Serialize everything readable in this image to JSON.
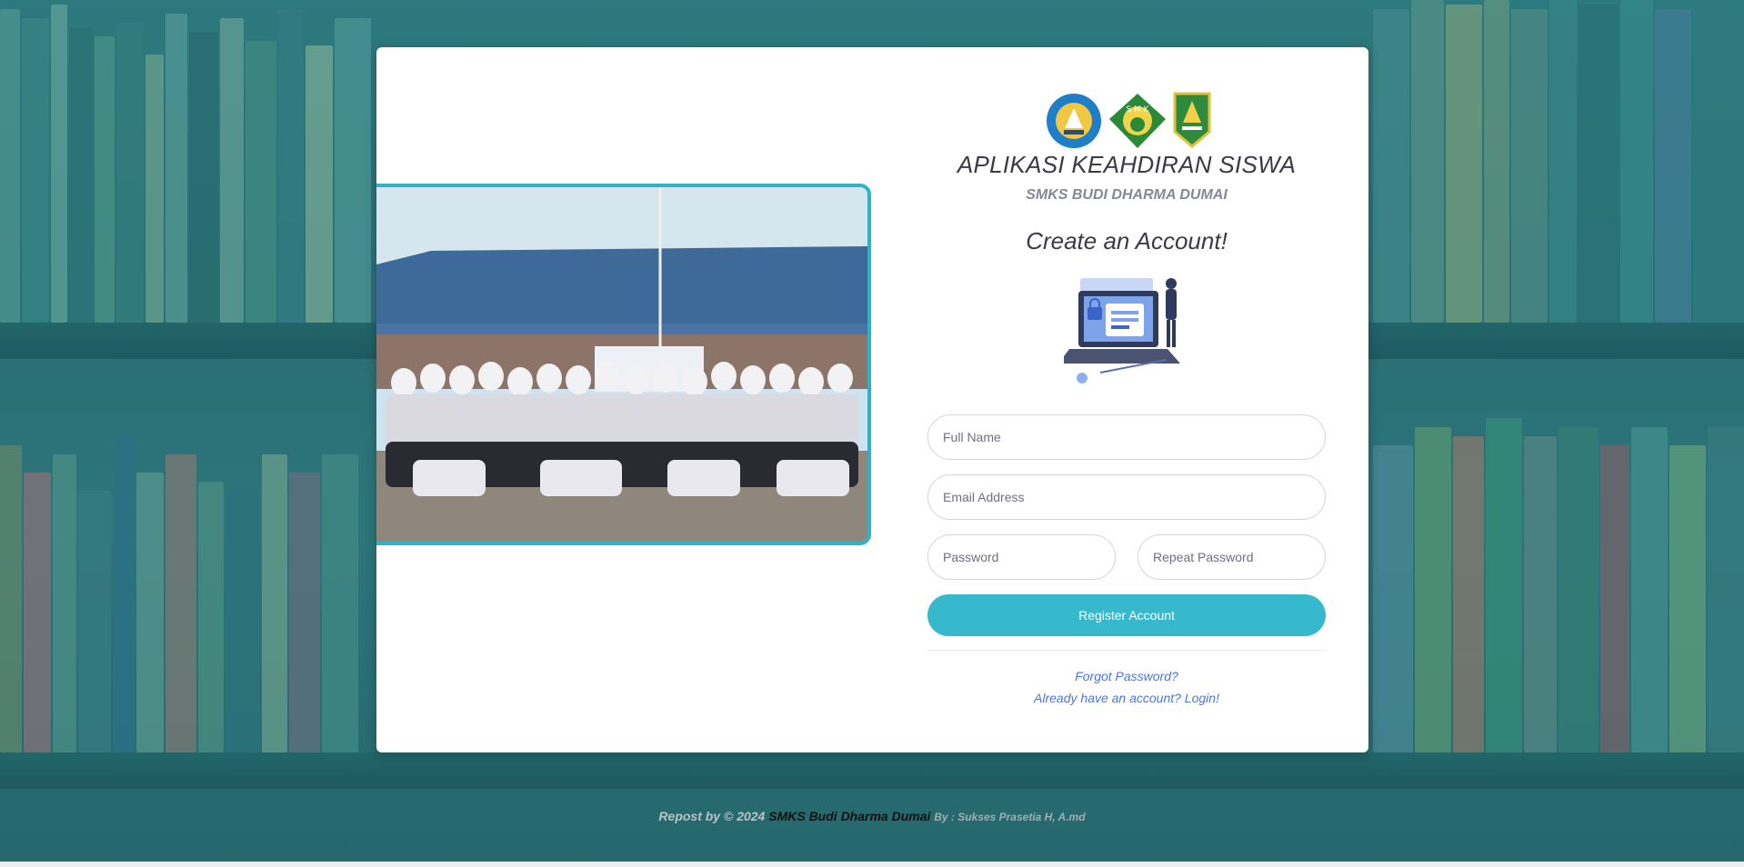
{
  "colors": {
    "accent": "#36b9cc",
    "photo_border": "#2fb2c8",
    "link": "#4e73df",
    "text_dark": "#3a3b45",
    "text_muted": "#858796"
  },
  "header": {
    "logos": [
      "tut-wuri-handayani-logo",
      "smk-logo",
      "riau-province-logo"
    ],
    "app_title": "APLIKASI KEAHDIRAN SISWA",
    "school_name": "SMKS BUDI DHARMA DUMAI",
    "page_heading": "Create an Account!"
  },
  "form": {
    "full_name_placeholder": "Full Name",
    "email_placeholder": "Email Address",
    "password_placeholder": "Password",
    "repeat_password_placeholder": "Repeat Password",
    "register_label": "Register Account"
  },
  "links": {
    "forgot_password": "Forgot Password?",
    "login": "Already have an account? Login!"
  },
  "footer": {
    "part1": "Repost by © 2024",
    "part2": "SMKS Budi Dharma Dumai",
    "part3": "By : Sukses Prasetia H, A.md"
  }
}
